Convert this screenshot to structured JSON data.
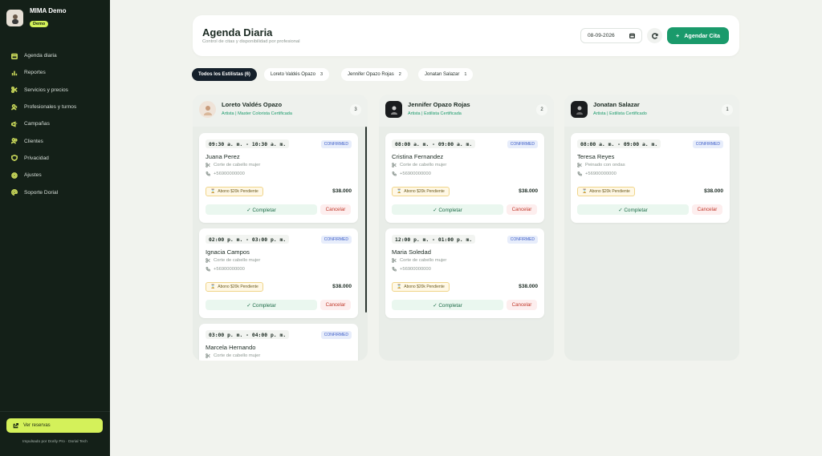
{
  "sidebar": {
    "brand_title": "MIMA Demo",
    "brand_badge": "Demo",
    "items": [
      {
        "label": "Agenda diaria",
        "icon": "calendar-icon"
      },
      {
        "label": "Reportes",
        "icon": "chart-icon"
      },
      {
        "label": "Servicios y precios",
        "icon": "scissors-icon"
      },
      {
        "label": "Profesionales y turnos",
        "icon": "users-icon"
      },
      {
        "label": "Campañas",
        "icon": "megaphone-icon"
      },
      {
        "label": "Clientes",
        "icon": "clients-icon"
      },
      {
        "label": "Privacidad",
        "icon": "shield-icon"
      },
      {
        "label": "Ajustes",
        "icon": "gear-icon"
      },
      {
        "label": "Soporte Dorial",
        "icon": "at-icon"
      }
    ],
    "view_bookings": "Ver reservas",
    "footer": "Impulsado por Dorily Pro · Dorial Tech"
  },
  "header": {
    "title": "Agenda Diaria",
    "subtitle": "Control de citas y disponibilidad por profesional",
    "date_value": "08-09-2026",
    "add_button": "Agendar Cita"
  },
  "filters": [
    {
      "label": "Todos los Estilistas (6)",
      "count": "",
      "active": true
    },
    {
      "label": "Loreto Valdés Opazo",
      "count": "3",
      "active": false
    },
    {
      "label": "Jennifer Opazo Rojas",
      "count": "2",
      "active": false
    },
    {
      "label": "Jonatan Salazar",
      "count": "1",
      "active": false
    }
  ],
  "columns": [
    {
      "name": "Loreto Valdés Opazo",
      "role": "Artista | Master Colorista Certificada",
      "count": "3",
      "cards": [
        {
          "time": "09:30 a. m. - 10:30 a. m.",
          "status": "CONFIRMED",
          "client": "Juana Perez",
          "service": "Corte de cabello mujer",
          "phone": "+56900000000",
          "pending": "Abono $20k Pendiente",
          "price": "$38.000",
          "complete": "✓ Completar",
          "cancel": "Cancelar"
        },
        {
          "time": "02:00 p. m. - 03:00 p. m.",
          "status": "CONFIRMED",
          "client": "Ignacia Campos",
          "service": "Corte de cabello mujer",
          "phone": "+56900000000",
          "pending": "Abono $20k Pendiente",
          "price": "$38.000",
          "complete": "✓ Completar",
          "cancel": "Cancelar"
        },
        {
          "time": "03:00 p. m. - 04:00 p. m.",
          "status": "CONFIRMED",
          "client": "Marcela Hernando",
          "service": "Corte de cabello mujer",
          "phone": "",
          "pending": "",
          "price": "",
          "complete": "",
          "cancel": ""
        }
      ]
    },
    {
      "name": "Jennifer Opazo Rojas",
      "role": "Artista | Estilista Certificada",
      "count": "2",
      "cards": [
        {
          "time": "08:00 a. m. - 09:00 a. m.",
          "status": "CONFIRMED",
          "client": "Cristina Fernandez",
          "service": "Corte de cabello mujer",
          "phone": "+56900000000",
          "pending": "Abono $20k Pendiente",
          "price": "$38.000",
          "complete": "✓ Completar",
          "cancel": "Cancelar"
        },
        {
          "time": "12:00 p. m. - 01:00 p. m.",
          "status": "CONFIRMED",
          "client": "Maria Soledad",
          "service": "Corte de cabello mujer",
          "phone": "+56900000000",
          "pending": "Abono $20k Pendiente",
          "price": "$38.000",
          "complete": "✓ Completar",
          "cancel": "Cancelar"
        }
      ]
    },
    {
      "name": "Jonatan Salazar",
      "role": "Artista | Estilista Certificado",
      "count": "1",
      "cards": [
        {
          "time": "08:00 a. m. - 09:00 a. m.",
          "status": "CONFIRMED",
          "client": "Teresa Reyes",
          "service": "Peinado con ondas",
          "phone": "+56900000000",
          "pending": "Abono $20k Pendiente",
          "price": "$38.000",
          "complete": "✓ Completar",
          "cancel": "Cancelar"
        }
      ]
    }
  ],
  "colors": {
    "accent": "#1a9a6b",
    "sidebar_bg": "#142018",
    "lime": "#d4f15a",
    "status_blue": "#3a5bc7",
    "cancel_red": "#c0392b"
  }
}
